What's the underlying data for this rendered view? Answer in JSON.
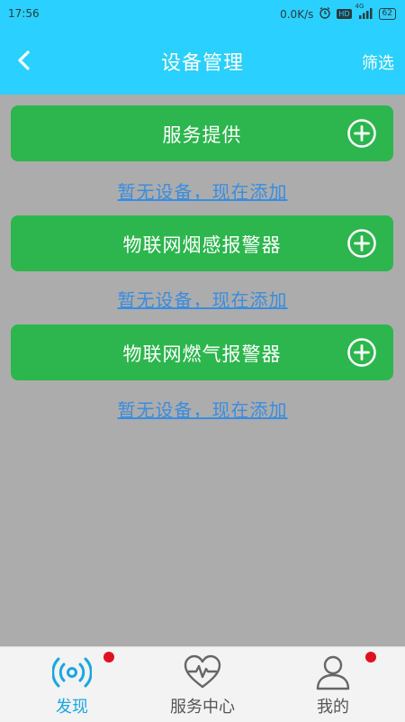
{
  "status_bar": {
    "time": "17:56",
    "network_speed": "0.0K/s",
    "hd_badge": "HD",
    "signal_label": "4G",
    "battery": "62"
  },
  "app_bar": {
    "title": "设备管理",
    "back_icon": "chevron-left-icon",
    "filter_label": "筛选"
  },
  "groups": [
    {
      "label": "服务提供",
      "add_icon": "plus-circle-icon",
      "empty_text": "暂无设备，现在添加"
    },
    {
      "label": "物联网烟感报警器",
      "add_icon": "plus-circle-icon",
      "empty_text": "暂无设备，现在添加"
    },
    {
      "label": "物联网燃气报警器",
      "add_icon": "plus-circle-icon",
      "empty_text": "暂无设备，现在添加"
    }
  ],
  "tab_bar": {
    "items": [
      {
        "label": "发现",
        "icon": "radar-icon",
        "active": true,
        "badge": true
      },
      {
        "label": "服务中心",
        "icon": "heart-pulse-icon",
        "active": false,
        "badge": false
      },
      {
        "label": "我的",
        "icon": "user-icon",
        "active": false,
        "badge": true
      }
    ]
  },
  "colors": {
    "header": "#2ad0ff",
    "group_bar": "#2cb64d",
    "link": "#3a8dde",
    "tab_active": "#1ba6e3",
    "badge": "#e0121f",
    "background": "#acacac"
  }
}
